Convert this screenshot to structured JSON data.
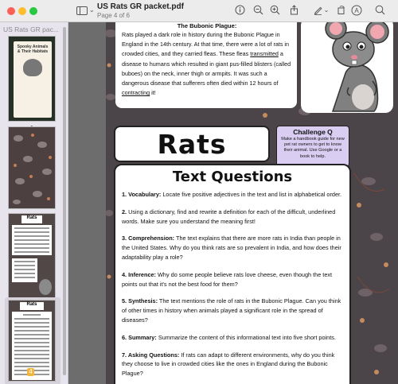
{
  "window": {
    "title": "US Rats GR packet.pdf",
    "subtitle": "Page 4 of 6"
  },
  "toolbar": {
    "icons": [
      "sidebar-icon",
      "chevron-down-icon",
      "info-icon",
      "zoom-out-icon",
      "zoom-in-icon",
      "share-icon",
      "markup-icon",
      "chevron-down-icon",
      "rotate-icon",
      "markup-circle-icon",
      "search-icon"
    ]
  },
  "sidebar": {
    "title": "US Rats GR pac...",
    "thumbnails": [
      {
        "label": "1",
        "cover_title": "Spooky Animals & Their Habitats"
      },
      {
        "label": "2"
      },
      {
        "label": "3",
        "heading": "Rats"
      },
      {
        "label": "4",
        "heading": "Rats",
        "selected": true
      }
    ]
  },
  "page3": {
    "heading": "The Bubonic Plague:",
    "body_part1": "Rats played a dark role in history during the Bubonic Plague in England in the 14th century. At that time, there were a lot of rats in crowded cities, and they carried fleas. These fleas ",
    "body_u1": "transmitted",
    "body_part2": " a disease to humans which resulted in giant pus-filled blisters (called buboes) on the neck, inner thigh or armpits. It was such a dangerous disease that sufferers often died within 12 hours of ",
    "body_u2": "contracting",
    "body_part3": " it!"
  },
  "page4": {
    "title": "Rats",
    "challenge": {
      "title": "Challenge Q",
      "body": "Make a handbook guide for new pet rat owners to get to know their animal. Use Google or a book to help."
    },
    "questions_title": "Text Questions",
    "questions": [
      {
        "label": "1. Vocabulary:",
        "text": " Locate five positive adjectives in the text and list in alphabetical order."
      },
      {
        "label": "2.",
        "text": " Using a dictionary, find and rewrite a definition for each of the difficult, underlined words. Make sure you understand the meaning first!"
      },
      {
        "label": "3. Comprehension:",
        "text": " The text explains that there are more rats in India than people in the United States. Why do you think rats are so prevalent in India, and how does their adaptability play a role?"
      },
      {
        "label": "4. Inference:",
        "text": " Why do some people believe rats love cheese, even though the text points out that it's not the best food for them?"
      },
      {
        "label": "5. Synthesis:",
        "text": " The text mentions the role of rats in the Bubonic Plague. Can you think of other times in history when animals played a significant role in the spread of diseases?"
      },
      {
        "label": "6. Summary:",
        "text": " Summarize the content of this informational text into five short points."
      },
      {
        "label": "7. Asking Questions:",
        "text": " If rats can adapt to different environments, why do you think they choose to live in crowded cities like the ones in England during the Bubonic Plague?"
      }
    ]
  },
  "colors": {
    "sidebar_bg": "#e8e4ee",
    "challenge_bg": "#d9cef2",
    "page_bg": "#4b4448",
    "selected_badge": "#f2b43a"
  }
}
